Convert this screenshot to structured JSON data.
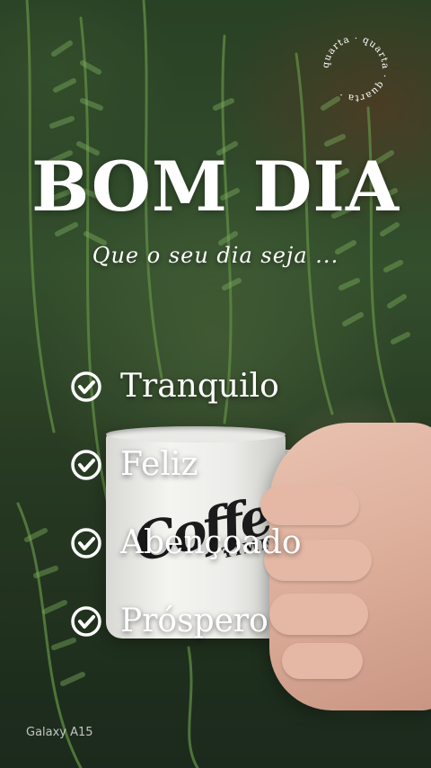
{
  "stamp": {
    "text": "quarta · quarta · quarta ·"
  },
  "header": {
    "title": "BOM DIA",
    "subtitle": "Que o seu dia seja ..."
  },
  "list": {
    "items": [
      {
        "label": "Tranquilo",
        "icon": "check-circle-icon"
      },
      {
        "label": "Feliz",
        "icon": "check-circle-icon"
      },
      {
        "label": "Abençoado",
        "icon": "check-circle-icon"
      },
      {
        "label": "Próspero",
        "icon": "check-circle-icon"
      }
    ]
  },
  "mug": {
    "logo_big": "Coffee",
    "logo_small": "TIME"
  },
  "watermark": {
    "text": "Galaxy A15"
  },
  "colors": {
    "text": "#ffffff",
    "foliage": "#3b5a33",
    "mug": "#f0f0ed"
  }
}
